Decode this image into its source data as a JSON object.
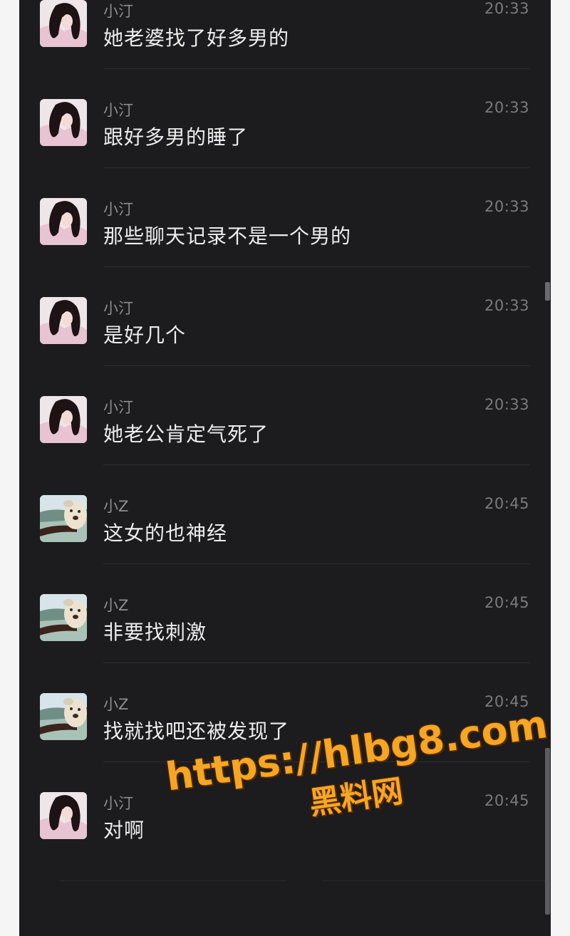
{
  "messages": [
    {
      "sender": "小汀",
      "avatar": "girl-avatar",
      "time": "20:33",
      "text": "她老婆找了好多男的"
    },
    {
      "sender": "小汀",
      "avatar": "girl-avatar",
      "time": "20:33",
      "text": "跟好多男的睡了"
    },
    {
      "sender": "小汀",
      "avatar": "girl-avatar",
      "time": "20:33",
      "text": "那些聊天记录不是一个男的"
    },
    {
      "sender": "小汀",
      "avatar": "girl-avatar",
      "time": "20:33",
      "text": "是好几个"
    },
    {
      "sender": "小汀",
      "avatar": "girl-avatar",
      "time": "20:33",
      "text": "她老公肯定气死了"
    },
    {
      "sender": "小Z",
      "avatar": "plush-toy-avatar",
      "time": "20:45",
      "text": "这女的也神经"
    },
    {
      "sender": "小Z",
      "avatar": "plush-toy-avatar",
      "time": "20:45",
      "text": "非要找刺激"
    },
    {
      "sender": "小Z",
      "avatar": "plush-toy-avatar",
      "time": "20:45",
      "text": "找就找吧还被发现了"
    },
    {
      "sender": "小汀",
      "avatar": "girl-avatar",
      "time": "20:45",
      "text": "对啊"
    }
  ],
  "watermark": {
    "url": "https://hlbg8.com",
    "site": "黑料网",
    "color": "#f5a623"
  },
  "colors": {
    "background": "#1c1c1e",
    "name": "#8e8e93",
    "message_text": "#ededed"
  }
}
